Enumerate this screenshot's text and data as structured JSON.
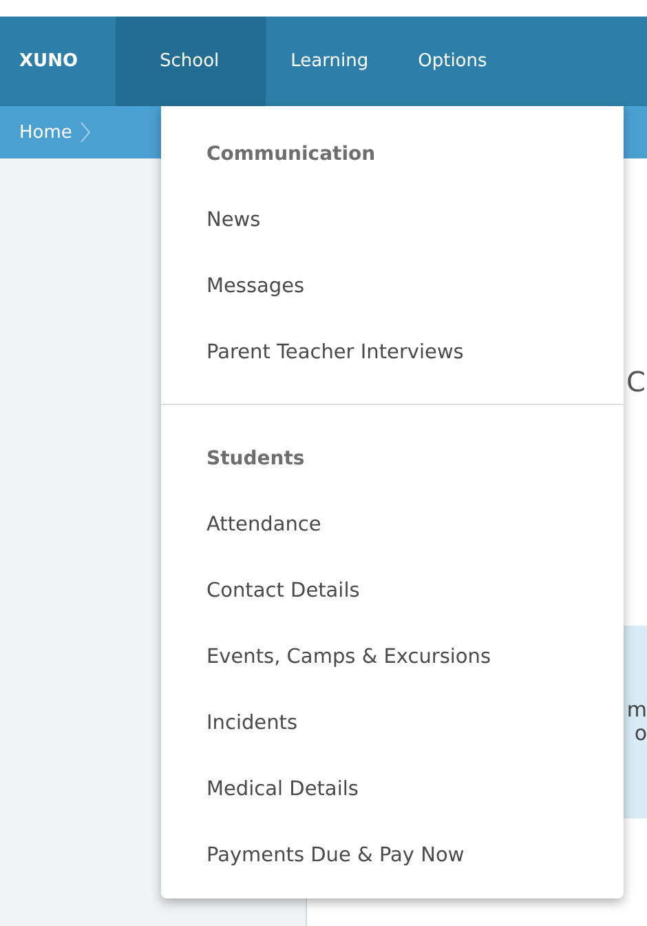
{
  "navbar": {
    "logo": "XUNO",
    "tabs": [
      {
        "label": "School",
        "selected": true
      },
      {
        "label": "Learning",
        "selected": false
      },
      {
        "label": "Options",
        "selected": false
      }
    ]
  },
  "breadcrumb": {
    "items": [
      "Home"
    ]
  },
  "background_fragments": [
    "C",
    "m",
    "o"
  ],
  "dropdown": {
    "sections": [
      {
        "heading": "Communication",
        "items": [
          "News",
          "Messages",
          "Parent Teacher Interviews"
        ]
      },
      {
        "heading": "Students",
        "items": [
          "Attendance",
          "Contact Details",
          "Events, Camps & Excursions",
          "Incidents",
          "Medical Details",
          "Payments Due & Pay Now"
        ]
      }
    ]
  }
}
